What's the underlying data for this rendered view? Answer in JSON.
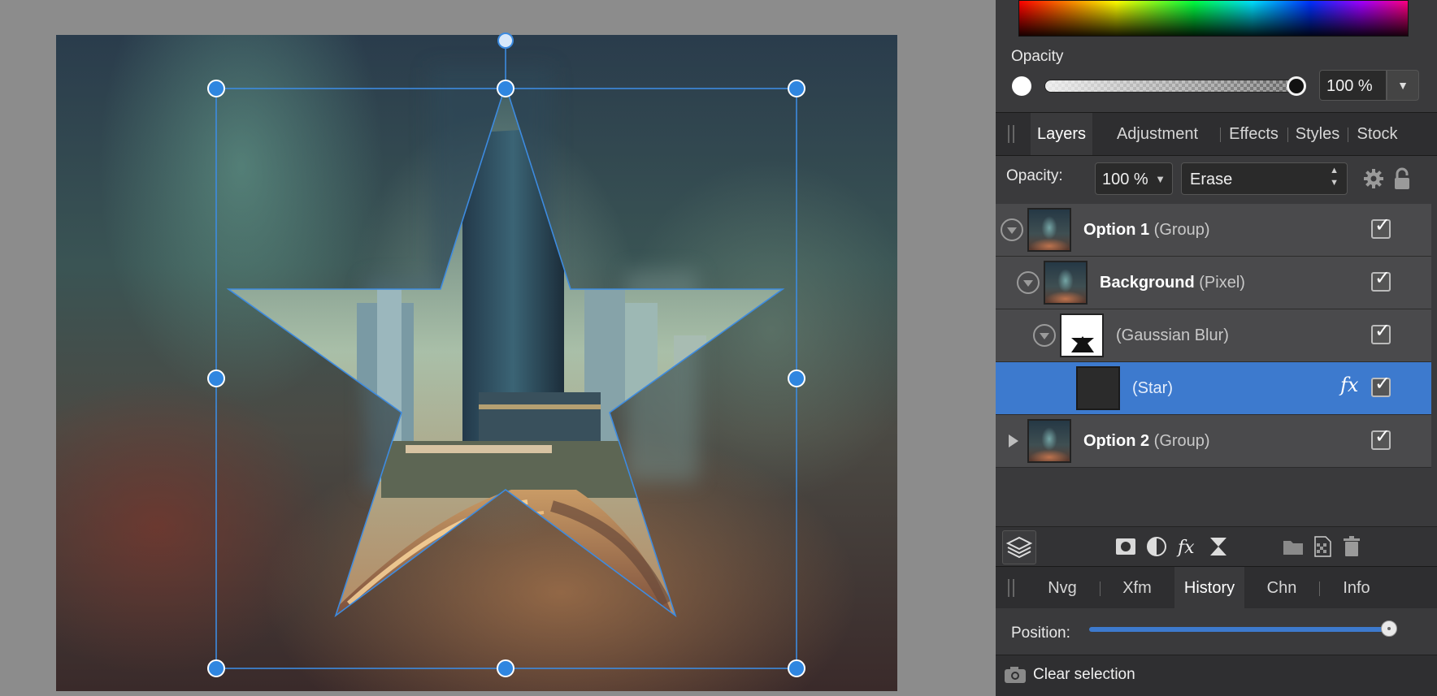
{
  "color": {
    "opacity_label": "Opacity",
    "opacity_value": "100 %",
    "opacity_level": 1.0
  },
  "layers_tabs": [
    "Layers",
    "Adjustment",
    "Effects",
    "Styles",
    "Stock"
  ],
  "layers_options": {
    "opacity_label": "Opacity:",
    "opacity_value": "100 %",
    "blend_mode": "Erase"
  },
  "layers": [
    {
      "name": "Option 1",
      "type": "(Group)",
      "visible": true
    },
    {
      "name": "Background",
      "type": "(Pixel)",
      "visible": true
    },
    {
      "name": "",
      "type": "(Gaussian Blur)",
      "visible": true
    },
    {
      "name": "",
      "type": "(Star)",
      "visible": true,
      "selected": true,
      "fx_label": "fx"
    },
    {
      "name": "Option 2",
      "type": "(Group)",
      "visible": true
    }
  ],
  "history_tabs": [
    "Nvg",
    "Xfm",
    "History",
    "Chn",
    "Info"
  ],
  "history": {
    "position_label": "Position:",
    "position_level": 1.0,
    "last_entry": "Clear selection"
  },
  "colors": {
    "accent": "#3d7ace",
    "handle": "#2f86e0",
    "panel_bg": "#3a3a3c"
  }
}
